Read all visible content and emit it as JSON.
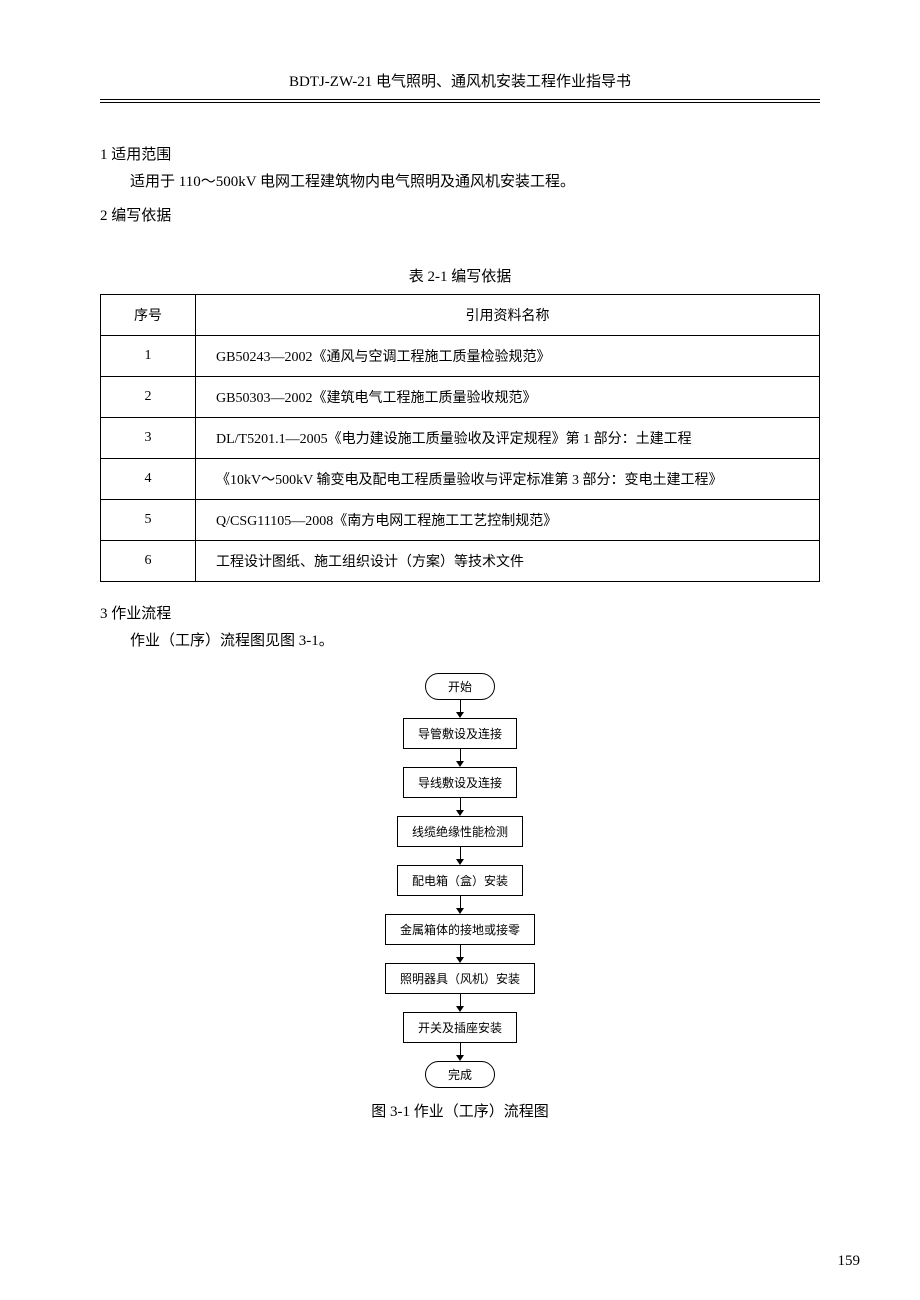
{
  "header": "BDTJ-ZW-21 电气照明、通风机安装工程作业指导书",
  "sections": {
    "s1_title": "1 适用范围",
    "s1_text": "适用于 110～500kV 电网工程建筑物内电气照明及通风机安装工程。",
    "s2_title": "2 编写依据",
    "s3_title": "3 作业流程",
    "s3_text": "作业（工序）流程图见图 3-1。"
  },
  "table": {
    "caption": "表 2-1 编写依据",
    "headers": {
      "seq": "序号",
      "name": "引用资料名称"
    },
    "rows": [
      {
        "seq": "1",
        "name": "GB50243—2002《通风与空调工程施工质量检验规范》"
      },
      {
        "seq": "2",
        "name": "GB50303—2002《建筑电气工程施工质量验收规范》"
      },
      {
        "seq": "3",
        "name": "DL/T5201.1—2005《电力建设施工质量验收及评定规程》第 1 部分：土建工程"
      },
      {
        "seq": "4",
        "name": "《10kV～500kV 输变电及配电工程质量验收与评定标准第 3 部分：变电土建工程》"
      },
      {
        "seq": "5",
        "name": "Q/CSG11105—2008《南方电网工程施工工艺控制规范》"
      },
      {
        "seq": "6",
        "name": "工程设计图纸、施工组织设计（方案）等技术文件"
      }
    ]
  },
  "flow": {
    "nodes": [
      "开始",
      "导管敷设及连接",
      "导线敷设及连接",
      "线缆绝缘性能检测",
      "配电箱（盒）安装",
      "金属箱体的接地或接零",
      "照明器具（风机）安装",
      "开关及插座安装",
      "完成"
    ],
    "caption": "图 3-1 作业（工序）流程图"
  },
  "page_number": "159",
  "chart_data": {
    "type": "table",
    "title": "表 2-1 编写依据",
    "columns": [
      "序号",
      "引用资料名称"
    ],
    "rows": [
      [
        "1",
        "GB50243—2002《通风与空调工程施工质量检验规范》"
      ],
      [
        "2",
        "GB50303—2002《建筑电气工程施工质量验收规范》"
      ],
      [
        "3",
        "DL/T5201.1—2005《电力建设施工质量验收及评定规程》第 1 部分：土建工程"
      ],
      [
        "4",
        "《10kV～500kV 输变电及配电工程质量验收与评定标准第 3 部分：变电土建工程》"
      ],
      [
        "5",
        "Q/CSG11105—2008《南方电网工程施工工艺控制规范》"
      ],
      [
        "6",
        "工程设计图纸、施工组织设计（方案）等技术文件"
      ]
    ]
  }
}
